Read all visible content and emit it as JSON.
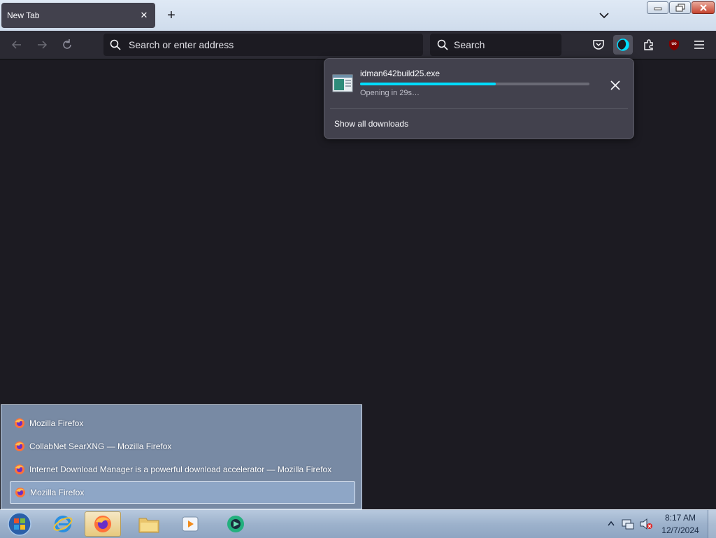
{
  "browser": {
    "tab": {
      "title": "New Tab",
      "close_glyph": "✕"
    },
    "new_tab_glyph": "+",
    "urlbar": {
      "placeholder": "Search or enter address"
    },
    "searchbar": {
      "placeholder": "Search"
    },
    "ublock_badge": "uo"
  },
  "downloads_panel": {
    "filename": "idman642build25.exe",
    "progress": 0.59,
    "status": "Opening in 29s…",
    "show_all": "Show all downloads"
  },
  "taskbar_thumbnails": {
    "items": [
      {
        "label": "Mozilla Firefox"
      },
      {
        "label": "CollabNet SearXNG — Mozilla Firefox"
      },
      {
        "label": "Internet Download Manager is a powerful download accelerator — Mozilla Firefox"
      },
      {
        "label": "Mozilla Firefox",
        "selected": true
      }
    ]
  },
  "taskbar": {
    "apps": [
      "start-orb",
      "internet-explorer",
      "firefox",
      "file-explorer",
      "media-player",
      "idm"
    ],
    "time": "8:17 AM",
    "date": "12/7/2024"
  },
  "colors": {
    "toolbar": "#2b2a33",
    "panel": "#42414d",
    "progress": "#00ddff",
    "content": "#1c1b22"
  }
}
